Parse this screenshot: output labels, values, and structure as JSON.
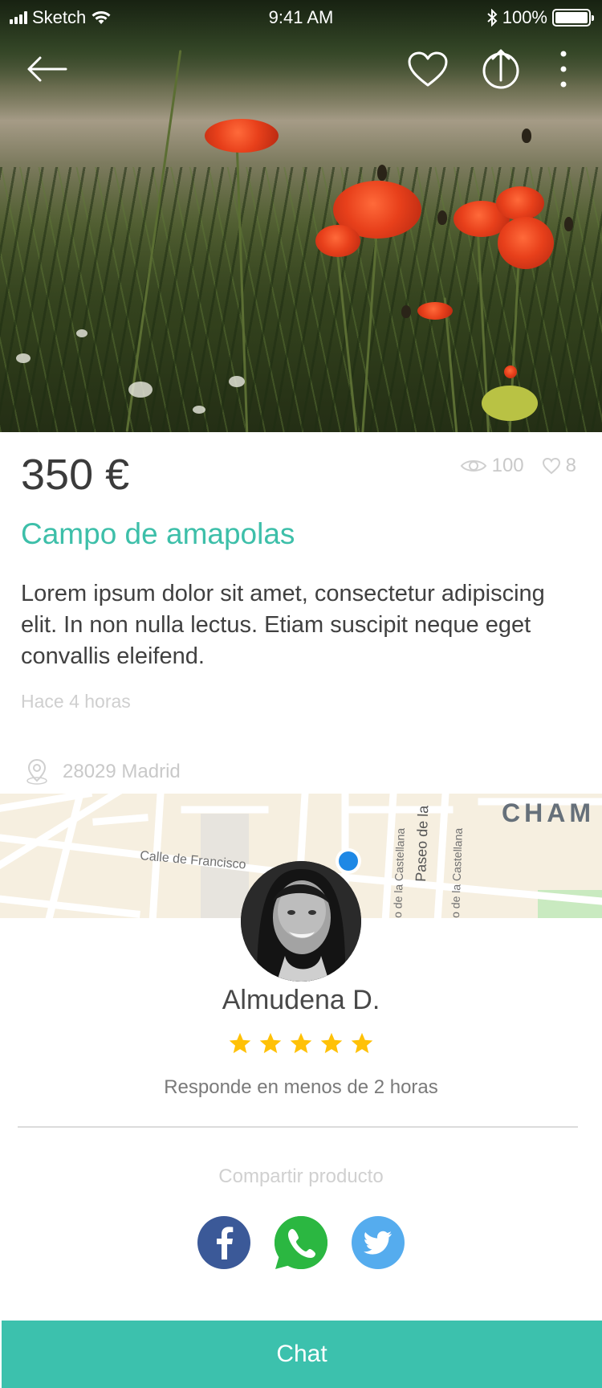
{
  "status_bar": {
    "carrier": "Sketch",
    "time": "9:41 AM",
    "battery": "100%"
  },
  "nav": {
    "back_icon": "arrow-left-icon",
    "favorite_icon": "heart-outline-icon",
    "share_icon": "share-upload-icon",
    "more_icon": "more-vertical-icon"
  },
  "product": {
    "price": "350 €",
    "views": "100",
    "likes": "8",
    "title": "Campo de amapolas",
    "description": "Lorem ipsum dolor sit amet, consectetur adipiscing elit. In non nulla lectus. Etiam suscipit neque eget convallis eleifend.",
    "posted": "Hace 4 horas",
    "location": "28029 Madrid"
  },
  "map": {
    "labels": [
      "CHAM",
      "Calle de Francisco",
      "Paseo de la",
      "o de la Castellana",
      "o de la Castellana"
    ]
  },
  "seller": {
    "name": "Almudena D.",
    "rating": 5,
    "rating_max": 5,
    "response_time": "Responde en menos de 2 horas"
  },
  "share": {
    "label": "Compartir producto",
    "networks": [
      "facebook",
      "whatsapp",
      "twitter"
    ]
  },
  "cta": {
    "chat_label": "Chat"
  },
  "colors": {
    "accent": "#3cc1ad",
    "title": "#3dbfa9",
    "star": "#ffc107",
    "facebook": "#3b5998",
    "whatsapp": "#2bb741",
    "twitter": "#55acee",
    "map_pin": "#1e88e5"
  }
}
